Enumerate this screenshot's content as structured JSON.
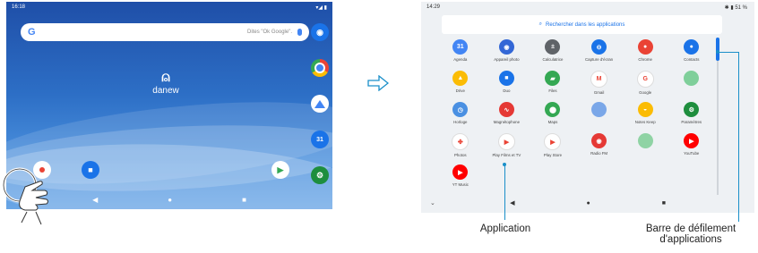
{
  "home": {
    "time": "16:18",
    "status_right": "▾◢ ▮",
    "search_g": "G",
    "search_hint": "Dites \"Ok Google\".",
    "brand_logo": "⍝",
    "brand_name": "danew"
  },
  "drawer": {
    "time": "14:29",
    "status_right": "✱ ▮ 51 %",
    "search_label": "Rechercher dans les applications",
    "rows": [
      [
        {
          "label": "Agenda",
          "icon": "calendar-icon",
          "color": "#4285f4",
          "glyph": "31"
        },
        {
          "label": "Appareil photo",
          "icon": "camera-icon",
          "color": "#3367d6",
          "glyph": "◉"
        },
        {
          "label": "Calculatrice",
          "icon": "calculator-icon",
          "color": "#5f6368",
          "glyph": "±"
        },
        {
          "label": "Capture d'écran",
          "icon": "screenshot-icon",
          "color": "#1a73e8",
          "glyph": "⊖"
        },
        {
          "label": "Chrome",
          "icon": "chrome-icon",
          "color": "#ea4335",
          "glyph": "●"
        },
        {
          "label": "Contacts",
          "icon": "contacts-icon",
          "color": "#1a73e8",
          "glyph": "●"
        }
      ],
      [
        {
          "label": "Drive",
          "icon": "drive-icon",
          "color": "#fbbc04",
          "glyph": "▲"
        },
        {
          "label": "Duo",
          "icon": "duo-icon",
          "color": "#1a73e8",
          "glyph": "■"
        },
        {
          "label": "Files",
          "icon": "files-icon",
          "color": "#34a853",
          "glyph": "▰"
        },
        {
          "label": "Gmail",
          "icon": "gmail-icon",
          "color": "#ffffff",
          "glyph": "M"
        },
        {
          "label": "Google",
          "icon": "google-icon",
          "color": "#ffffff",
          "glyph": "G"
        },
        {
          "label": "",
          "icon": "blurred-app-icon",
          "color": "#7fcf9a",
          "glyph": ""
        }
      ],
      [
        {
          "label": "Horloge",
          "icon": "clock-icon",
          "color": "#4a90e2",
          "glyph": "◷"
        },
        {
          "label": "Magnétophone",
          "icon": "recorder-icon",
          "color": "#e53935",
          "glyph": "∿"
        },
        {
          "label": "Maps",
          "icon": "maps-icon",
          "color": "#34a853",
          "glyph": "⬤"
        },
        {
          "label": "",
          "icon": "blurred-app-icon",
          "color": "#7aa7e8",
          "glyph": ""
        },
        {
          "label": "Notes Keep",
          "icon": "keep-icon",
          "color": "#fbbc04",
          "glyph": "◒"
        },
        {
          "label": "Paramètres",
          "icon": "settings-icon",
          "color": "#1e8e3e",
          "glyph": "⚙"
        }
      ],
      [
        {
          "label": "Photos",
          "icon": "photos-icon",
          "color": "#ffffff",
          "glyph": "✤"
        },
        {
          "label": "Play Films et TV",
          "icon": "play-movies-icon",
          "color": "#ffffff",
          "glyph": "▶"
        },
        {
          "label": "Play Store",
          "icon": "play-store-icon",
          "color": "#ffffff",
          "glyph": "▶"
        },
        {
          "label": "Radio FM",
          "icon": "radio-icon",
          "color": "#e53935",
          "glyph": "◉"
        },
        {
          "label": "",
          "icon": "blurred-app-icon",
          "color": "#8fd3a4",
          "glyph": ""
        },
        {
          "label": "YouTube",
          "icon": "youtube-icon",
          "color": "#ff0000",
          "glyph": "▶"
        }
      ],
      [
        {
          "label": "YT Music",
          "icon": "yt-music-icon",
          "color": "#ff0000",
          "glyph": "▶"
        }
      ]
    ]
  },
  "callouts": {
    "application": "Application",
    "scrollbar_line1": "Barre  de défilement",
    "scrollbar_line2": "d'applications"
  }
}
